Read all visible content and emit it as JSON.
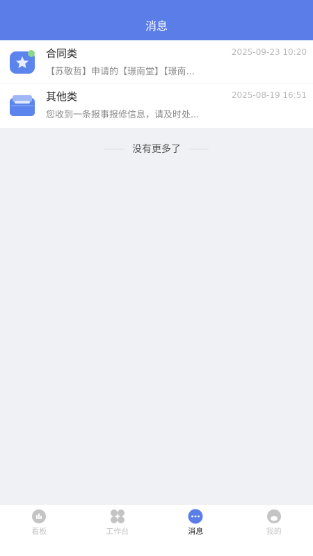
{
  "header": {
    "title": "消息"
  },
  "messages": [
    {
      "icon": "contract-star-icon",
      "title": "合同类",
      "time": "2025-09-23 10:20",
      "preview": "【苏敬哲】申请的【璟南堂】【璟南..."
    },
    {
      "icon": "cabinet-icon",
      "title": "其他类",
      "time": "2025-08-19 16:51",
      "preview": "您收到一条报事报修信息，请及时处..."
    }
  ],
  "footer_note": "没有更多了",
  "tabbar": {
    "tabs": [
      {
        "icon": "dashboard-icon",
        "label": "看板",
        "active": false
      },
      {
        "icon": "workbench-icon",
        "label": "工作台",
        "active": false
      },
      {
        "icon": "message-icon",
        "label": "消息",
        "active": true
      },
      {
        "icon": "profile-icon",
        "label": "我的",
        "active": false
      }
    ]
  },
  "colors": {
    "brand": "#5b7de8",
    "background": "#f0f1f5",
    "tab_inactive": "#c4c4c4",
    "tab_active_text": "#222222",
    "badge_green": "#8ad68a"
  }
}
